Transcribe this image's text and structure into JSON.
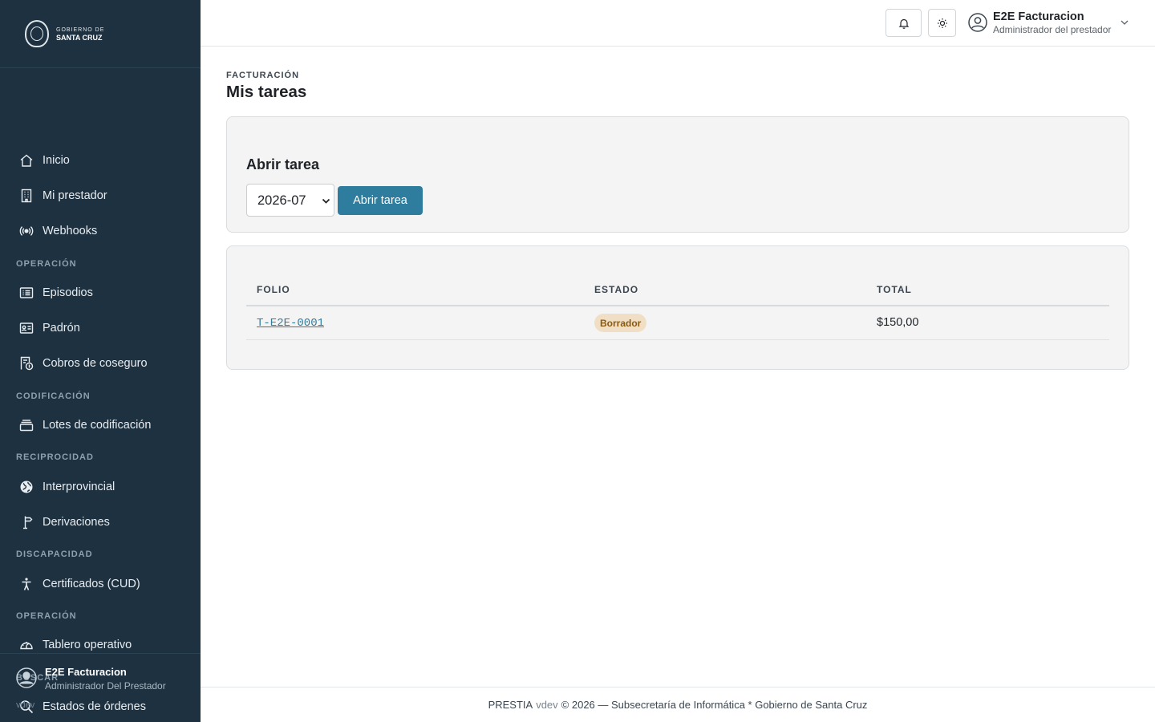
{
  "sidebar": {
    "logo": {
      "line1": "GOBIERNO DE",
      "line2": "SANTA CRUZ"
    },
    "items": [
      {
        "label": "Inicio",
        "icon": "home-icon"
      },
      {
        "label": "Mi prestador",
        "icon": "building-icon"
      },
      {
        "label": "Webhooks",
        "icon": "broadcast-icon"
      },
      {
        "label": "Episodios",
        "icon": "list-card-icon"
      },
      {
        "label": "Padrón",
        "icon": "id-card-icon"
      },
      {
        "label": "Cobros de coseguro",
        "icon": "receipt-coin-icon"
      },
      {
        "label": "Lotes de codificación",
        "icon": "stack-icon"
      },
      {
        "label": "Interprovincial",
        "icon": "globe-icon"
      },
      {
        "label": "Derivaciones",
        "icon": "signpost-icon"
      },
      {
        "label": "Certificados (CUD)",
        "icon": "accessibility-icon"
      },
      {
        "label": "Tablero operativo",
        "icon": "gauge-icon"
      },
      {
        "label": "Estados de órdenes",
        "icon": "search-icon"
      }
    ],
    "sections": {
      "operacion": "OPERACIÓN",
      "codificacion": "CODIFICACIÓN",
      "reciprocidad": "RECIPROCIDAD",
      "discapacidad": "DISCAPACIDAD",
      "operacion2": "OPERACIÓN",
      "buscar": "BUSCAR"
    },
    "user": {
      "name": "E2E Facturacion",
      "role": "Administrador Del Prestador"
    },
    "version": "vdev"
  },
  "header": {
    "user_name": "E2E Facturacion",
    "user_role": "Administrador del prestador"
  },
  "page": {
    "eyebrow": "FACTURACIÓN",
    "title": "Mis tareas"
  },
  "open_task": {
    "title": "Abrir tarea",
    "period_value": "2026-07",
    "button_label": "Abrir tarea"
  },
  "table": {
    "columns": [
      "FOLIO",
      "ESTADO",
      "TOTAL"
    ],
    "rows": [
      {
        "folio": "T-E2E-0001",
        "estado": "Borrador",
        "total": "$150,00"
      }
    ]
  },
  "footer": {
    "brand": "PRESTIA",
    "version": "vdev",
    "text": "© 2026 — Subsecretaría de Informática * Gobierno de Santa Cruz"
  },
  "colors": {
    "sidebar_bg": "#1e3140",
    "accent": "#2e7d9e",
    "badge_bg": "#f1dfc5",
    "badge_text": "#8a5a10"
  }
}
